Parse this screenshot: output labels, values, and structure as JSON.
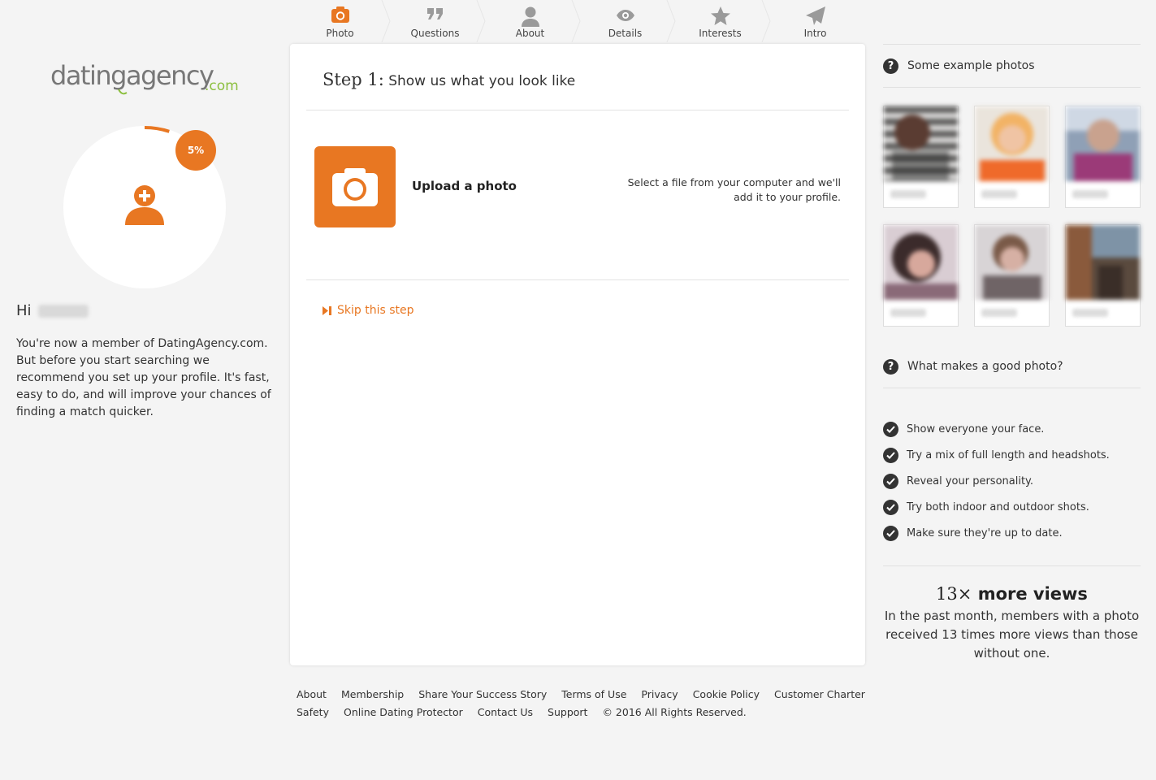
{
  "steps": [
    {
      "label": "Photo",
      "icon": "camera-icon",
      "active": true
    },
    {
      "label": "Questions",
      "icon": "quote-icon",
      "active": false
    },
    {
      "label": "About",
      "icon": "person-icon",
      "active": false
    },
    {
      "label": "Details",
      "icon": "eye-icon",
      "active": false
    },
    {
      "label": "Interests",
      "icon": "star-icon",
      "active": false
    },
    {
      "label": "Intro",
      "icon": "paper-plane-icon",
      "active": false
    }
  ],
  "brand": {
    "logo_text_main": "datingagency",
    "logo_text_tld": ".com",
    "accent": "#e87722",
    "logo_green": "#8cbf3f"
  },
  "profile": {
    "completion": 0.05,
    "completion_label": "5%",
    "greeting": "Hi",
    "intro": "You're now a member of DatingAgency.com. But before you start searching we recommend you set up your profile. It's fast, easy to do, and will improve your chances of finding a match quicker."
  },
  "card": {
    "step_no": "Step 1:",
    "title": "Show us what you look like",
    "upload_label": "Upload a photo",
    "upload_help": "Select a file from your computer and we'll add it to your profile.",
    "skip_label": "Skip this step"
  },
  "footer": {
    "row1": [
      "About",
      "Membership",
      "Share Your Success Story",
      "Terms of Use",
      "Privacy",
      "Cookie Policy",
      "Customer Charter"
    ],
    "row2": [
      "Safety",
      "Online Dating Protector",
      "Contact Us",
      "Support"
    ],
    "copyright": "© 2016 All Rights Reserved."
  },
  "sidebar": {
    "examples_heading": "Some example photos",
    "tips_heading": "What makes a good photo?",
    "tips": [
      "Show everyone your face.",
      "Try a mix of full length and headshots.",
      "Reveal your personality.",
      "Try both indoor and outdoor shots.",
      "Make sure they're up to date."
    ],
    "views_number": "13×",
    "views_heading": "more views",
    "views_text": "In the past month, members with a photo received 13 times more views than those without one."
  }
}
